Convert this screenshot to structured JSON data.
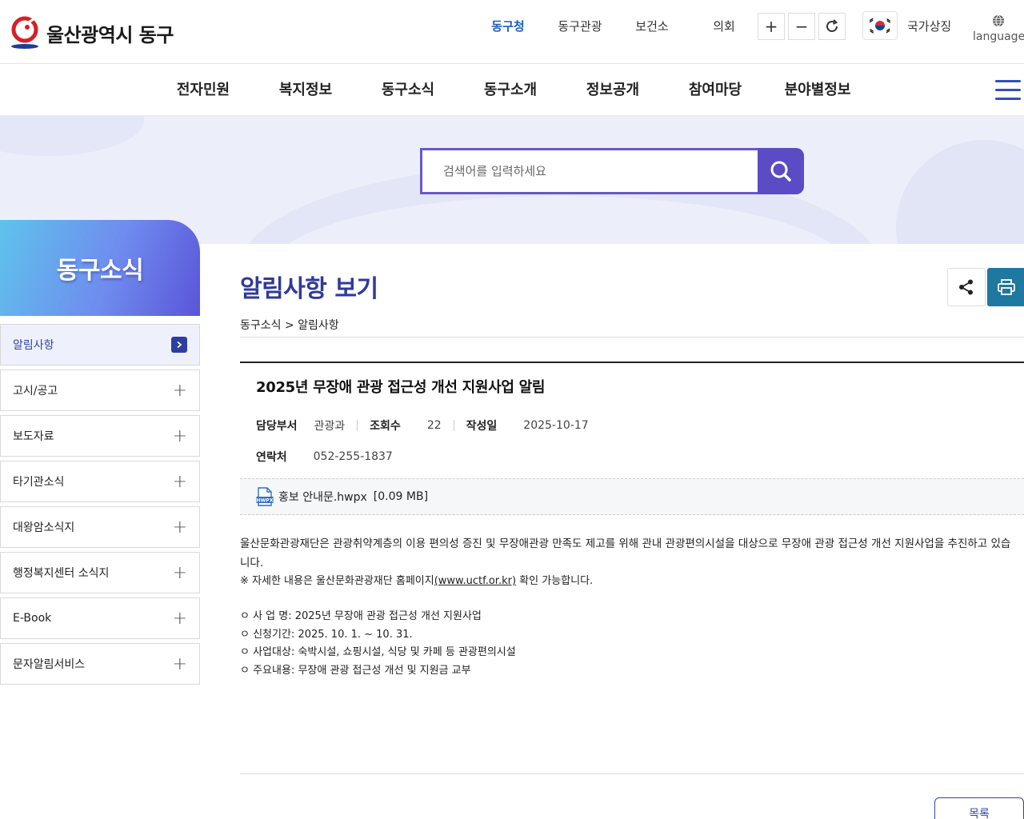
{
  "header": {
    "logo_text": "울산광역시 동구",
    "site_links": [
      "동구청",
      "동구관광",
      "보건소",
      "의회"
    ],
    "active_site": "동구청",
    "zoom_in": "+",
    "zoom_out": "−",
    "national_symbol": "국가상징",
    "language": "language"
  },
  "gnb": {
    "items": [
      "전자민원",
      "복지정보",
      "동구소식",
      "동구소개",
      "정보공개",
      "참여마당",
      "분야별정보"
    ]
  },
  "search": {
    "placeholder": "검색어를 입력하세요"
  },
  "lnb": {
    "title": "동구소식",
    "items": [
      "알림사항",
      "고시/공고",
      "보도자료",
      "타기관소식",
      "대왕암소식지",
      "행정복지센터 소식지",
      "E-Book",
      "문자알림서비스"
    ],
    "active": "알림사항"
  },
  "content": {
    "page_title": "알림사항 보기",
    "breadcrumb": "동구소식 > 알림사항",
    "article": {
      "title": "2025년 무장애 관광 접근성 개선 지원사업 알림",
      "dept_label": "담당부서",
      "dept": "관광과",
      "views_label": "조회수",
      "views": "22",
      "date_label": "작성일",
      "date": "2025-10-17",
      "contact_label": "연락처",
      "contact": "052-255-1837",
      "attachment": {
        "name": "홍보 안내문.hwpx",
        "size": "[0.09 MB]"
      },
      "intro": "울산문화관광재단은 관광취약계층의 이용 편의성 증진 및 무장애관광 만족도 제고를 위해 관내 관광편의시설을 대상으로 무장애 관광 접근성 개선 지원사업을 추진하고 있습니다.",
      "note_prefix": "※ 자세한 내용은 울산문화관광재단 홈페이지",
      "note_link": "(www.uctf.or.kr)",
      "note_suffix": " 확인 가능합니다.",
      "bullets": [
        "ㅇ 사  업  명: 2025년 무장애 관광 접근성 개선 지원사업",
        "ㅇ 신청기간: 2025. 10. 1. ~ 10. 31.",
        "ㅇ 사업대상: 숙박시설, 쇼핑시설, 식당 및 카페 등 관광편의시설",
        "ㅇ 주요내용: 무장애 관광 접근성 개선 및 지원금 교부"
      ]
    },
    "list_button": "목록"
  },
  "colors": {
    "primary": "#2f3a9a",
    "search_accent": "#5b4bc4",
    "print_button": "#1e78a0",
    "active_link": "#1f5fb8"
  }
}
